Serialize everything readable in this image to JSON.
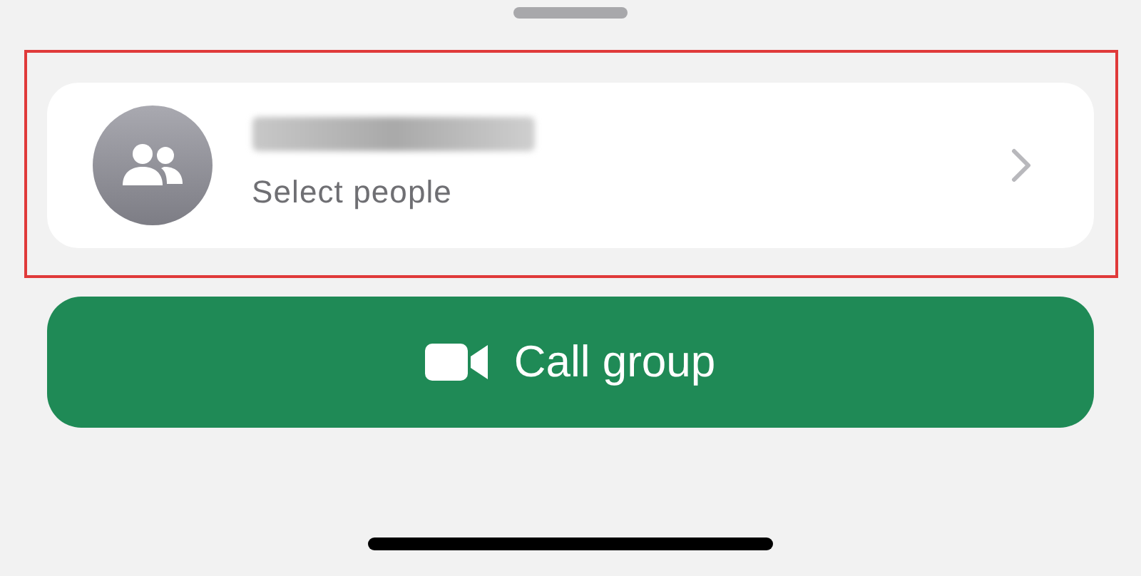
{
  "contact": {
    "subtitle": "Select people"
  },
  "call_button": {
    "label": "Call group"
  }
}
